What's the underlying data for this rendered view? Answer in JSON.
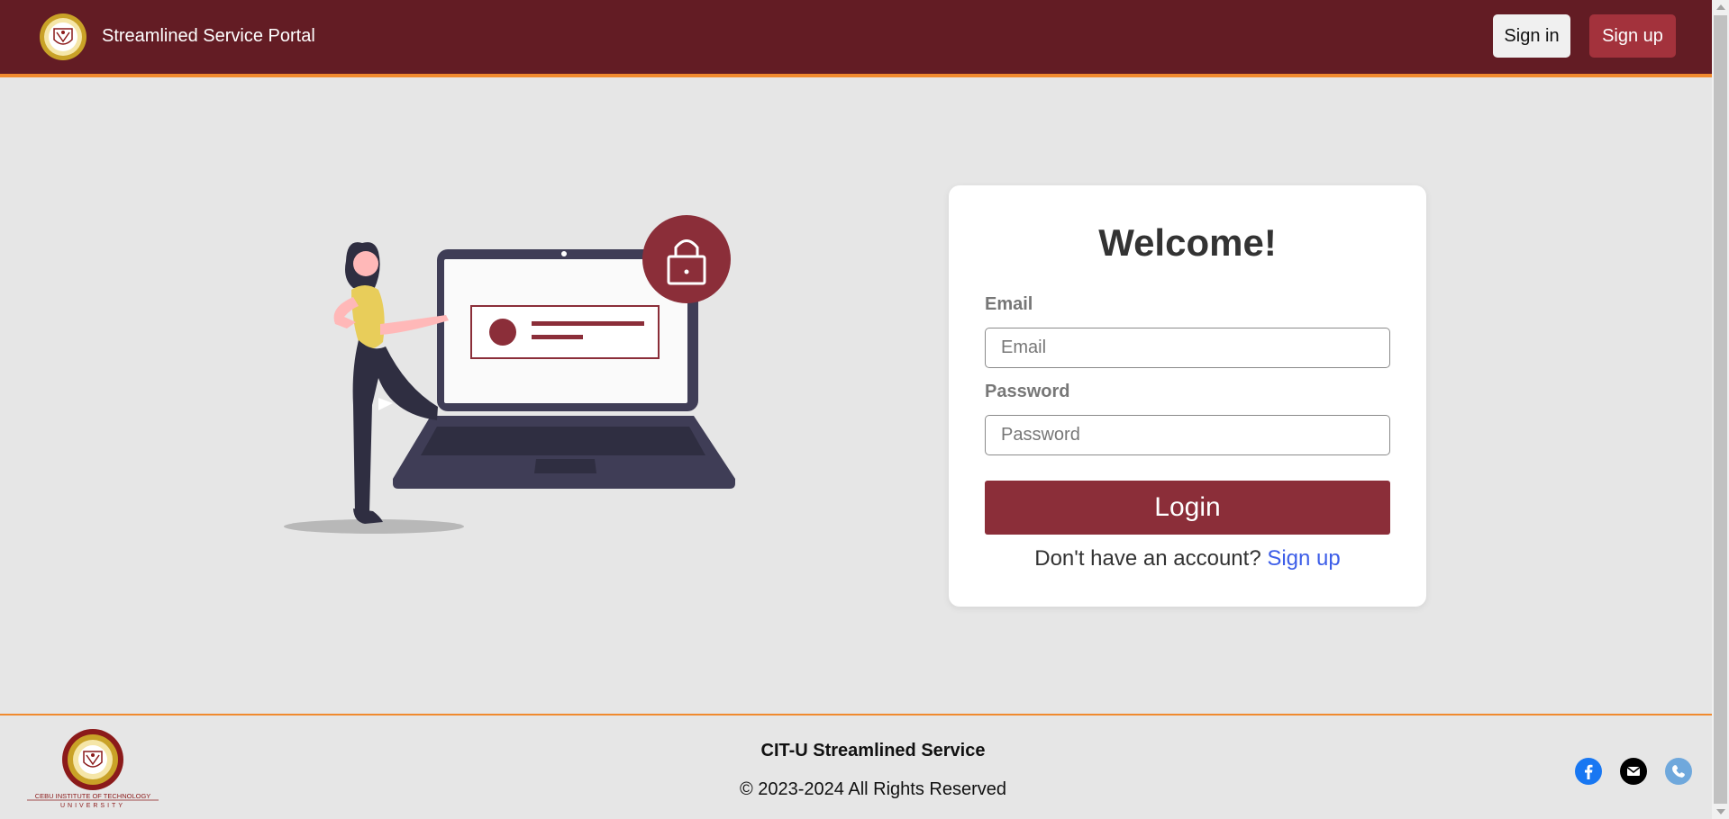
{
  "header": {
    "brand": "Streamlined Service Portal",
    "sign_in_label": "Sign in",
    "sign_up_label": "Sign up"
  },
  "login_card": {
    "title": "Welcome!",
    "email_label": "Email",
    "email_placeholder": "Email",
    "email_value": "",
    "password_label": "Password",
    "password_placeholder": "Password",
    "password_value": "",
    "login_label": "Login",
    "no_account_text": "Don't have an account?",
    "sign_up_link": "Sign up"
  },
  "footer": {
    "title": "CIT-U Streamlined Service",
    "copyright": "© 2023-2024 All Rights Reserved",
    "logo_caption_top": "CEBU INSTITUTE OF TECHNOLOGY",
    "logo_caption_bottom": "UNIVERSITY",
    "social_icons": [
      "facebook-icon",
      "email-icon",
      "phone-icon"
    ]
  },
  "colors": {
    "header_bg": "#631c24",
    "accent_orange": "#f08a2e",
    "sign_up_button": "#a3323c",
    "login_button": "#8b2e39",
    "link_blue": "#3d5ee8",
    "page_bg": "#e6e6e6"
  }
}
